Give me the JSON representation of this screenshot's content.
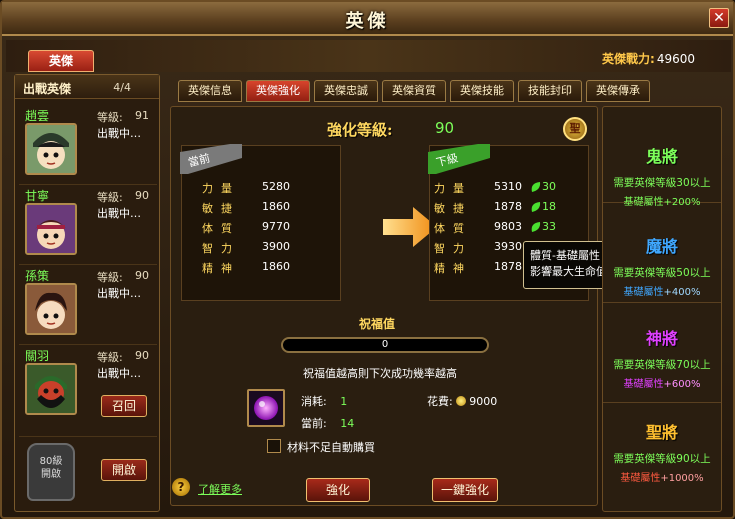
{
  "window": {
    "title": "英傑",
    "close_label": "✕"
  },
  "header": {
    "main_tab": "英傑",
    "power_label": "英傑戰力:",
    "power_value": "49600"
  },
  "roster": {
    "title": "出戰英傑",
    "count": "4/4",
    "level_label": "等級:",
    "heroes": [
      {
        "name": "趙雲",
        "level": "91",
        "status": "出戰中…"
      },
      {
        "name": "甘寧",
        "level": "90",
        "status": "出戰中…"
      },
      {
        "name": "孫策",
        "level": "90",
        "status": "出戰中…"
      },
      {
        "name": "關羽",
        "level": "90",
        "status": "出戰中…"
      }
    ],
    "recall_button": "召回",
    "locked_slot": "80級\n開啟",
    "open_button": "開啟"
  },
  "tabs": [
    "英傑信息",
    "英傑強化",
    "英傑忠誠",
    "英傑資質",
    "英傑技能",
    "技能封印",
    "英傑傳承"
  ],
  "enhance": {
    "title": "強化等級:",
    "level": "90",
    "seal_label": "聖",
    "current_label": "當前",
    "next_label": "下級",
    "stat_labels": [
      "力量",
      "敏捷",
      "体質",
      "智力",
      "精神"
    ],
    "current_values": [
      "5280",
      "1860",
      "9770",
      "3900",
      "1860"
    ],
    "next_values": [
      "5310",
      "1878",
      "9803",
      "3930",
      "1878"
    ],
    "increases": [
      "30",
      "18",
      "33"
    ],
    "tooltip_line1": "體質-基礎屬性",
    "tooltip_line2": "影響最大生命值。",
    "bless_title": "祝福值",
    "bless_value": "0",
    "bless_desc": "祝福值越高則下次成功幾率越高",
    "consume_label": "消耗:",
    "consume_value": "1",
    "current_have_label": "當前:",
    "current_have_value": "14",
    "cost_label": "花費:",
    "cost_value": "9000",
    "auto_buy": "材料不足自動購買",
    "learn_more": "了解更多",
    "enhance_button": "強化",
    "one_click_button": "一鍵強化"
  },
  "ranks": [
    {
      "name": "鬼將",
      "req": "需要英傑等級30以上",
      "attr_label": "基礎屬性",
      "attr_value": "+200%",
      "color": "#7dff5a",
      "label_color": "#7dff5a"
    },
    {
      "name": "魔將",
      "req": "需要英傑等級50以上",
      "attr_label": "基礎屬性",
      "attr_value": "+400%",
      "color": "#40a8ff",
      "label_color": "#40a8ff"
    },
    {
      "name": "神將",
      "req": "需要英傑等級70以上",
      "attr_label": "基礎屬性",
      "attr_value": "+600%",
      "color": "#e040ff",
      "label_color": "#e040ff"
    },
    {
      "name": "聖將",
      "req": "需要英傑等級90以上",
      "attr_label": "基礎屬性",
      "attr_value": "+1000%",
      "color": "#ffc030",
      "label_color": "#ff5a40"
    }
  ]
}
